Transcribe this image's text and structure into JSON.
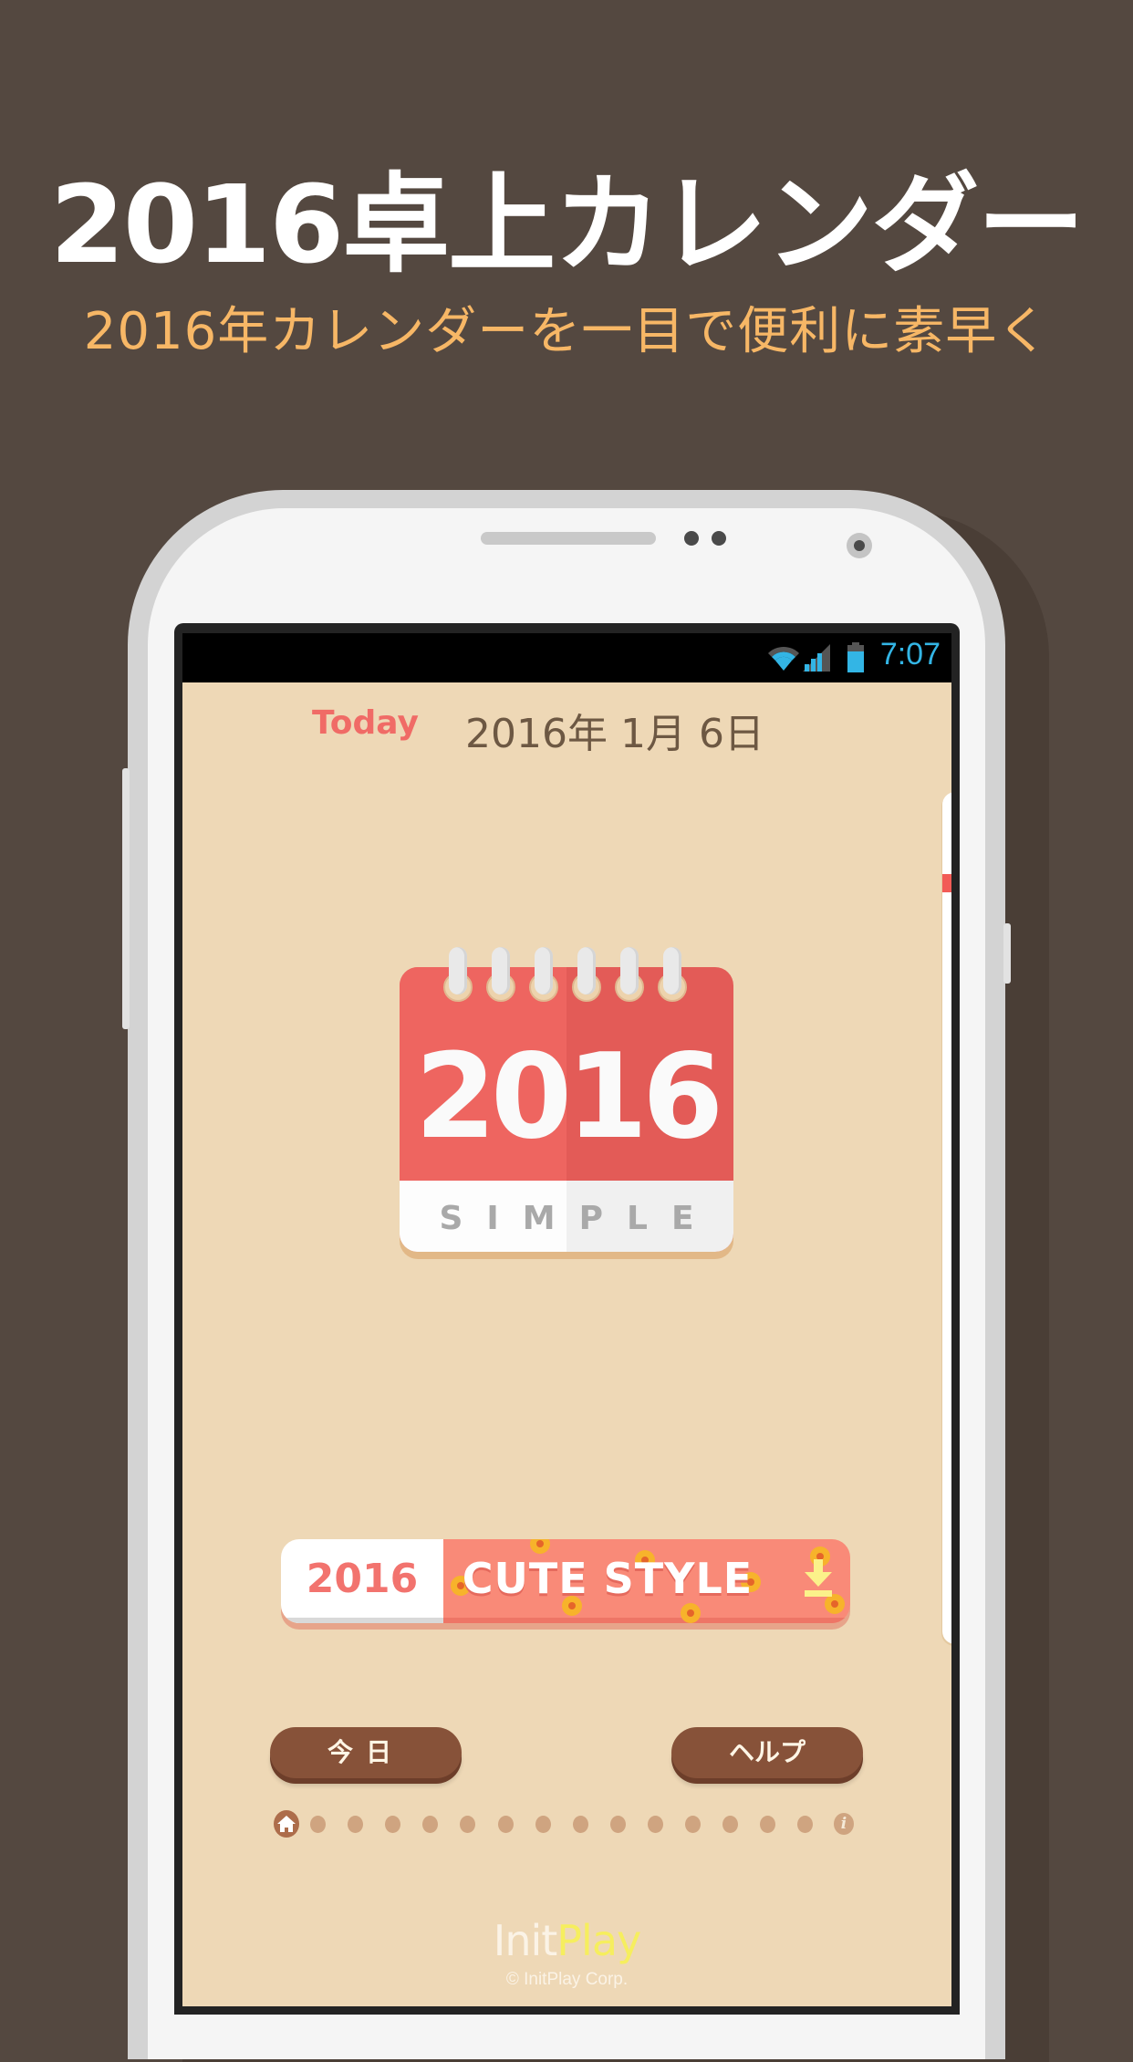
{
  "promo": {
    "title": "2016卓上カレンダー",
    "subtitle": "2016年カレンダーを一目で便利に素早く"
  },
  "statusbar": {
    "time": "7:07",
    "icons": [
      "wifi-icon",
      "signal-icon",
      "battery-icon"
    ],
    "accent": "#33b5e5"
  },
  "header": {
    "today_label": "Today",
    "date": "2016年  1月  6日"
  },
  "calendar_icon": {
    "year": "2016",
    "style": "SIMPLE",
    "color": "#e35b57"
  },
  "banner": {
    "year": "2016",
    "title": "CUTE STYLE",
    "action_icon": "download-icon"
  },
  "buttons": {
    "today": "今日",
    "help": "ヘルプ"
  },
  "pager": {
    "first_icon": "home-icon",
    "dot_count": 14,
    "last_icon": "info-icon",
    "info_glyph": "i",
    "active_index": 0
  },
  "footer": {
    "logo_init": "Init",
    "logo_play": "Play",
    "copyright": "© InitPlay Corp."
  }
}
